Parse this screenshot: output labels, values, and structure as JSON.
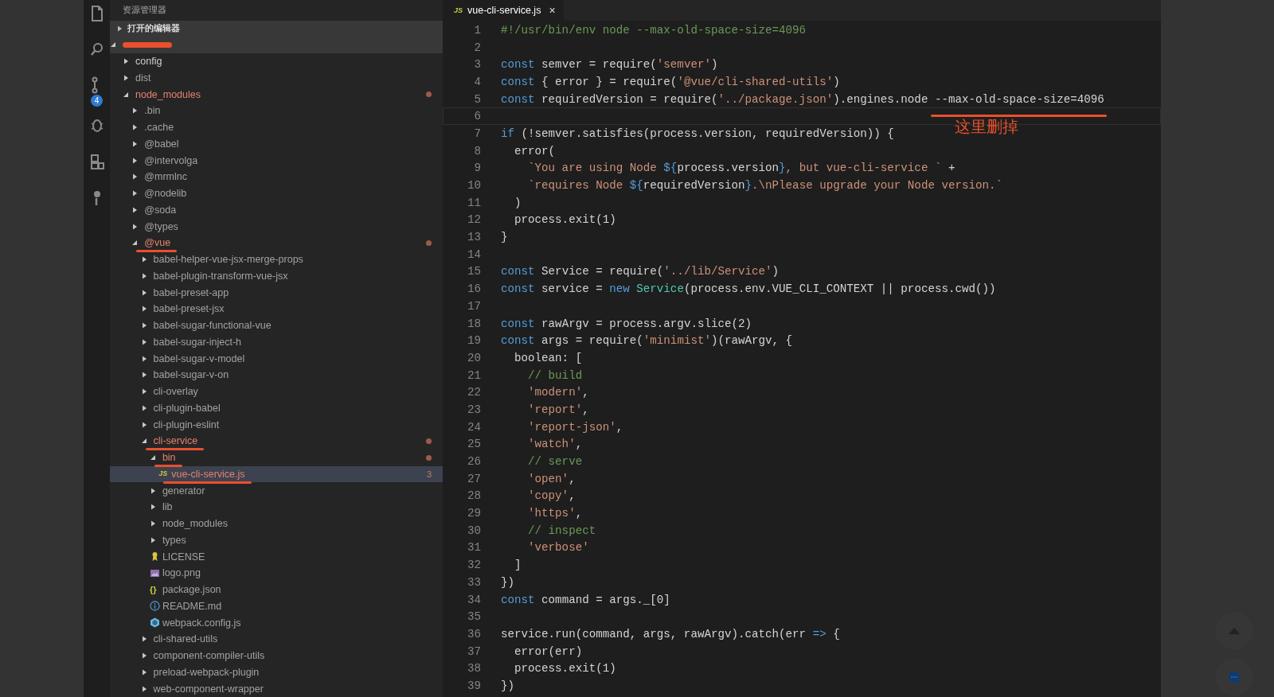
{
  "activity_bar": {
    "scm_badge": "4"
  },
  "explorer": {
    "title": "资源管理器",
    "open_editors": {
      "label": "打开的编辑器",
      "expanded": false
    },
    "tree": [
      {
        "redacted": true,
        "kind": "folder",
        "expanded": true,
        "selected": false,
        "children": [
          {
            "name": "config",
            "kind": "folder",
            "expanded": false,
            "modified": false,
            "ignored": false,
            "selected": false,
            "underlined": false
          },
          {
            "name": "dist",
            "kind": "folder",
            "expanded": false,
            "modified": false,
            "ignored": true,
            "selected": false,
            "underlined": false
          },
          {
            "name": "node_modules",
            "kind": "folder",
            "expanded": true,
            "modified": true,
            "ignored": false,
            "selected": false,
            "underlined": false,
            "children": [
              {
                "name": ".bin",
                "kind": "folder",
                "expanded": false,
                "modified": false,
                "ignored": true,
                "selected": false,
                "underlined": false
              },
              {
                "name": ".cache",
                "kind": "folder",
                "expanded": false,
                "modified": false,
                "ignored": true,
                "selected": false,
                "underlined": false
              },
              {
                "name": "@babel",
                "kind": "folder",
                "expanded": false,
                "modified": false,
                "ignored": true,
                "selected": false,
                "underlined": false
              },
              {
                "name": "@intervolga",
                "kind": "folder",
                "expanded": false,
                "modified": false,
                "ignored": true,
                "selected": false,
                "underlined": false
              },
              {
                "name": "@mrmlnc",
                "kind": "folder",
                "expanded": false,
                "modified": false,
                "ignored": true,
                "selected": false,
                "underlined": false
              },
              {
                "name": "@nodelib",
                "kind": "folder",
                "expanded": false,
                "modified": false,
                "ignored": true,
                "selected": false,
                "underlined": false
              },
              {
                "name": "@soda",
                "kind": "folder",
                "expanded": false,
                "modified": false,
                "ignored": true,
                "selected": false,
                "underlined": false
              },
              {
                "name": "@types",
                "kind": "folder",
                "expanded": false,
                "modified": false,
                "ignored": true,
                "selected": false,
                "underlined": false
              },
              {
                "name": "@vue",
                "kind": "folder",
                "expanded": true,
                "modified": true,
                "ignored": false,
                "selected": false,
                "underlined": true,
                "children": [
                  {
                    "name": "babel-helper-vue-jsx-merge-props",
                    "kind": "folder",
                    "expanded": false,
                    "modified": false,
                    "ignored": true,
                    "selected": false,
                    "underlined": false
                  },
                  {
                    "name": "babel-plugin-transform-vue-jsx",
                    "kind": "folder",
                    "expanded": false,
                    "modified": false,
                    "ignored": true,
                    "selected": false,
                    "underlined": false
                  },
                  {
                    "name": "babel-preset-app",
                    "kind": "folder",
                    "expanded": false,
                    "modified": false,
                    "ignored": true,
                    "selected": false,
                    "underlined": false
                  },
                  {
                    "name": "babel-preset-jsx",
                    "kind": "folder",
                    "expanded": false,
                    "modified": false,
                    "ignored": true,
                    "selected": false,
                    "underlined": false
                  },
                  {
                    "name": "babel-sugar-functional-vue",
                    "kind": "folder",
                    "expanded": false,
                    "modified": false,
                    "ignored": true,
                    "selected": false,
                    "underlined": false
                  },
                  {
                    "name": "babel-sugar-inject-h",
                    "kind": "folder",
                    "expanded": false,
                    "modified": false,
                    "ignored": true,
                    "selected": false,
                    "underlined": false
                  },
                  {
                    "name": "babel-sugar-v-model",
                    "kind": "folder",
                    "expanded": false,
                    "modified": false,
                    "ignored": true,
                    "selected": false,
                    "underlined": false
                  },
                  {
                    "name": "babel-sugar-v-on",
                    "kind": "folder",
                    "expanded": false,
                    "modified": false,
                    "ignored": true,
                    "selected": false,
                    "underlined": false
                  },
                  {
                    "name": "cli-overlay",
                    "kind": "folder",
                    "expanded": false,
                    "modified": false,
                    "ignored": true,
                    "selected": false,
                    "underlined": false
                  },
                  {
                    "name": "cli-plugin-babel",
                    "kind": "folder",
                    "expanded": false,
                    "modified": false,
                    "ignored": true,
                    "selected": false,
                    "underlined": false
                  },
                  {
                    "name": "cli-plugin-eslint",
                    "kind": "folder",
                    "expanded": false,
                    "modified": false,
                    "ignored": true,
                    "selected": false,
                    "underlined": false
                  },
                  {
                    "name": "cli-service",
                    "kind": "folder",
                    "expanded": true,
                    "modified": true,
                    "ignored": false,
                    "selected": false,
                    "underlined": true,
                    "children": [
                      {
                        "name": "bin",
                        "kind": "folder",
                        "expanded": true,
                        "modified": true,
                        "ignored": false,
                        "selected": false,
                        "underlined": true,
                        "children": [
                          {
                            "name": "vue-cli-service.js",
                            "kind": "js",
                            "icon": "JS",
                            "problems": "3",
                            "modified": true,
                            "ignored": false,
                            "selected": true,
                            "underlined": true
                          }
                        ]
                      },
                      {
                        "name": "generator",
                        "kind": "folder",
                        "expanded": false,
                        "modified": false,
                        "ignored": true,
                        "selected": false,
                        "underlined": false
                      },
                      {
                        "name": "lib",
                        "kind": "folder",
                        "expanded": false,
                        "modified": false,
                        "ignored": true,
                        "selected": false,
                        "underlined": false
                      },
                      {
                        "name": "node_modules",
                        "kind": "folder",
                        "expanded": false,
                        "modified": false,
                        "ignored": true,
                        "selected": false,
                        "underlined": false
                      },
                      {
                        "name": "types",
                        "kind": "folder",
                        "expanded": false,
                        "modified": false,
                        "ignored": true,
                        "selected": false,
                        "underlined": false
                      },
                      {
                        "name": "LICENSE",
                        "kind": "license",
                        "modified": false,
                        "ignored": true,
                        "selected": false,
                        "underlined": false
                      },
                      {
                        "name": "logo.png",
                        "kind": "image",
                        "modified": false,
                        "ignored": true,
                        "selected": false,
                        "underlined": false
                      },
                      {
                        "name": "package.json",
                        "kind": "json",
                        "icon": "{}",
                        "modified": false,
                        "ignored": true,
                        "selected": false,
                        "underlined": false
                      },
                      {
                        "name": "README.md",
                        "kind": "info",
                        "modified": false,
                        "ignored": true,
                        "selected": false,
                        "underlined": false
                      },
                      {
                        "name": "webpack.config.js",
                        "kind": "webpack",
                        "modified": false,
                        "ignored": true,
                        "selected": false,
                        "underlined": false
                      }
                    ]
                  },
                  {
                    "name": "cli-shared-utils",
                    "kind": "folder",
                    "expanded": false,
                    "modified": false,
                    "ignored": true,
                    "selected": false,
                    "underlined": false
                  },
                  {
                    "name": "component-compiler-utils",
                    "kind": "folder",
                    "expanded": false,
                    "modified": false,
                    "ignored": true,
                    "selected": false,
                    "underlined": false
                  },
                  {
                    "name": "preload-webpack-plugin",
                    "kind": "folder",
                    "expanded": false,
                    "modified": false,
                    "ignored": true,
                    "selected": false,
                    "underlined": false
                  },
                  {
                    "name": "web-component-wrapper",
                    "kind": "folder",
                    "expanded": false,
                    "modified": false,
                    "ignored": true,
                    "selected": false,
                    "underlined": false
                  }
                ]
              }
            ]
          }
        ]
      }
    ]
  },
  "editor": {
    "tabs": [
      {
        "label": "vue-cli-service.js",
        "icon": "JS",
        "close": "×",
        "selected": true
      }
    ],
    "lines": [
      {
        "number": "1",
        "current": false,
        "tokens": [
          {
            "kind": "com",
            "text": "#!/usr/bin/env node --max-old-space-size=4096"
          }
        ]
      },
      {
        "number": "2",
        "current": false
      },
      {
        "number": "3",
        "current": false,
        "tokens": [
          {
            "kind": "kw",
            "text": "const"
          },
          {
            "kind": "plain",
            "text": " semver = require("
          },
          {
            "kind": "str",
            "text": "'semver'"
          },
          {
            "kind": "plain",
            "text": ")"
          }
        ]
      },
      {
        "number": "4",
        "current": false,
        "tokens": [
          {
            "kind": "kw",
            "text": "const"
          },
          {
            "kind": "plain",
            "text": " { error } = require("
          },
          {
            "kind": "str",
            "text": "'@vue/cli-shared-utils'"
          },
          {
            "kind": "plain",
            "text": ")"
          }
        ]
      },
      {
        "number": "5",
        "current": false,
        "note": "这里删掉",
        "tokens": [
          {
            "kind": "kw",
            "text": "const"
          },
          {
            "kind": "plain",
            "text": " requiredVersion = require("
          },
          {
            "kind": "str",
            "text": "'../package.json'"
          },
          {
            "kind": "plain",
            "text": ").engines.node "
          },
          {
            "kind": "plain",
            "text": "--max-old-space-size=4096",
            "underlined": true
          }
        ]
      },
      {
        "number": "6",
        "current": true
      },
      {
        "number": "7",
        "current": false,
        "tokens": [
          {
            "kind": "kw",
            "text": "if"
          },
          {
            "kind": "plain",
            "text": " (!semver.satisfies(process.version, requiredVersion)) {"
          }
        ]
      },
      {
        "number": "8",
        "current": false,
        "tokens": [
          {
            "kind": "plain",
            "text": "  error("
          }
        ]
      },
      {
        "number": "9",
        "current": false,
        "tokens": [
          {
            "kind": "str",
            "text": "    `You are using Node "
          },
          {
            "kind": "kw",
            "text": "${"
          },
          {
            "kind": "plain",
            "text": "process.version"
          },
          {
            "kind": "kw",
            "text": "}"
          },
          {
            "kind": "str",
            "text": ", but vue-cli-service `"
          },
          {
            "kind": "plain",
            "text": " +"
          }
        ]
      },
      {
        "number": "10",
        "current": false,
        "tokens": [
          {
            "kind": "str",
            "text": "    `requires Node "
          },
          {
            "kind": "kw",
            "text": "${"
          },
          {
            "kind": "plain",
            "text": "requiredVersion"
          },
          {
            "kind": "kw",
            "text": "}"
          },
          {
            "kind": "str",
            "text": ".\\nPlease upgrade your Node version.`"
          }
        ]
      },
      {
        "number": "11",
        "current": false,
        "tokens": [
          {
            "kind": "plain",
            "text": "  )"
          }
        ]
      },
      {
        "number": "12",
        "current": false,
        "tokens": [
          {
            "kind": "plain",
            "text": "  process.exit(1)"
          }
        ]
      },
      {
        "number": "13",
        "current": false,
        "tokens": [
          {
            "kind": "plain",
            "text": "}"
          }
        ]
      },
      {
        "number": "14",
        "current": false
      },
      {
        "number": "15",
        "current": false,
        "tokens": [
          {
            "kind": "kw",
            "text": "const"
          },
          {
            "kind": "plain",
            "text": " Service = require("
          },
          {
            "kind": "str",
            "text": "'../lib/Service'"
          },
          {
            "kind": "plain",
            "text": ")"
          }
        ]
      },
      {
        "number": "16",
        "current": false,
        "tokens": [
          {
            "kind": "kw",
            "text": "const"
          },
          {
            "kind": "plain",
            "text": " service = "
          },
          {
            "kind": "kw",
            "text": "new "
          },
          {
            "kind": "cls",
            "text": "Service"
          },
          {
            "kind": "plain",
            "text": "(process.env.VUE_CLI_CONTEXT || process.cwd())"
          }
        ]
      },
      {
        "number": "17",
        "current": false
      },
      {
        "number": "18",
        "current": false,
        "tokens": [
          {
            "kind": "kw",
            "text": "const"
          },
          {
            "kind": "plain",
            "text": " rawArgv = process.argv.slice(2)"
          }
        ]
      },
      {
        "number": "19",
        "current": false,
        "tokens": [
          {
            "kind": "kw",
            "text": "const"
          },
          {
            "kind": "plain",
            "text": " args = require("
          },
          {
            "kind": "str",
            "text": "'minimist'"
          },
          {
            "kind": "plain",
            "text": ")(rawArgv, {"
          }
        ]
      },
      {
        "number": "20",
        "current": false,
        "tokens": [
          {
            "kind": "plain",
            "text": "  boolean: ["
          }
        ]
      },
      {
        "number": "21",
        "current": false,
        "tokens": [
          {
            "kind": "com",
            "text": "    // build"
          }
        ]
      },
      {
        "number": "22",
        "current": false,
        "tokens": [
          {
            "kind": "str",
            "text": "    'modern'"
          },
          {
            "kind": "plain",
            "text": ","
          }
        ]
      },
      {
        "number": "23",
        "current": false,
        "tokens": [
          {
            "kind": "str",
            "text": "    'report'"
          },
          {
            "kind": "plain",
            "text": ","
          }
        ]
      },
      {
        "number": "24",
        "current": false,
        "tokens": [
          {
            "kind": "str",
            "text": "    'report-json'"
          },
          {
            "kind": "plain",
            "text": ","
          }
        ]
      },
      {
        "number": "25",
        "current": false,
        "tokens": [
          {
            "kind": "str",
            "text": "    'watch'"
          },
          {
            "kind": "plain",
            "text": ","
          }
        ]
      },
      {
        "number": "26",
        "current": false,
        "tokens": [
          {
            "kind": "com",
            "text": "    // serve"
          }
        ]
      },
      {
        "number": "27",
        "current": false,
        "tokens": [
          {
            "kind": "str",
            "text": "    'open'"
          },
          {
            "kind": "plain",
            "text": ","
          }
        ]
      },
      {
        "number": "28",
        "current": false,
        "tokens": [
          {
            "kind": "str",
            "text": "    'copy'"
          },
          {
            "kind": "plain",
            "text": ","
          }
        ]
      },
      {
        "number": "29",
        "current": false,
        "tokens": [
          {
            "kind": "str",
            "text": "    'https'"
          },
          {
            "kind": "plain",
            "text": ","
          }
        ]
      },
      {
        "number": "30",
        "current": false,
        "tokens": [
          {
            "kind": "com",
            "text": "    // inspect"
          }
        ]
      },
      {
        "number": "31",
        "current": false,
        "tokens": [
          {
            "kind": "str",
            "text": "    'verbose'"
          }
        ]
      },
      {
        "number": "32",
        "current": false,
        "tokens": [
          {
            "kind": "plain",
            "text": "  ]"
          }
        ]
      },
      {
        "number": "33",
        "current": false,
        "tokens": [
          {
            "kind": "plain",
            "text": "})"
          }
        ]
      },
      {
        "number": "34",
        "current": false,
        "tokens": [
          {
            "kind": "kw",
            "text": "const"
          },
          {
            "kind": "plain",
            "text": " command = args._[0]"
          }
        ]
      },
      {
        "number": "35",
        "current": false
      },
      {
        "number": "36",
        "current": false,
        "tokens": [
          {
            "kind": "plain",
            "text": "service.run(command, args, rawArgv).catch(err "
          },
          {
            "kind": "kw",
            "text": "=>"
          },
          {
            "kind": "plain",
            "text": " {"
          }
        ]
      },
      {
        "number": "37",
        "current": false,
        "tokens": [
          {
            "kind": "plain",
            "text": "  error(err)"
          }
        ]
      },
      {
        "number": "38",
        "current": false,
        "tokens": [
          {
            "kind": "plain",
            "text": "  process.exit(1)"
          }
        ]
      },
      {
        "number": "39",
        "current": false,
        "tokens": [
          {
            "kind": "plain",
            "text": "})"
          }
        ]
      }
    ]
  }
}
